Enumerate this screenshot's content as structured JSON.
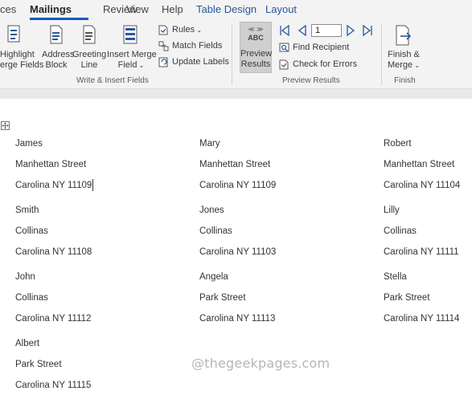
{
  "tabs": {
    "references_partial": "ces",
    "mailings": "Mailings",
    "review": "Review",
    "view": "View",
    "help": "Help",
    "table_design": "Table Design",
    "layout": "Layout"
  },
  "ribbon": {
    "write_insert": {
      "highlight_l1": "Highlight",
      "highlight_l2": "erge Fields",
      "address_l1": "Address",
      "address_l2": "Block",
      "greeting_l1": "Greeting",
      "greeting_l2": "Line",
      "insert_l1": "Insert Merge",
      "insert_l2": "Field",
      "rules": "Rules",
      "match": "Match Fields",
      "update": "Update Labels",
      "group_label": "Write & Insert Fields"
    },
    "preview": {
      "abc_glyph": "ABC",
      "preview_l1": "Preview",
      "preview_l2": "Results",
      "record_value": "1",
      "find_recipient": "Find Recipient",
      "check_errors": "Check for Errors",
      "group_label": "Preview Results"
    },
    "finish": {
      "finish_l1": "Finish &",
      "finish_l2": "Merge",
      "group_label": "Finish"
    }
  },
  "document": {
    "labels": [
      [
        "James",
        "Manhettan Street",
        "Carolina NY 11109"
      ],
      [
        "Mary",
        "Manhettan Street",
        "Carolina NY 11109"
      ],
      [
        "Robert",
        "Manhettan Street",
        "Carolina NY 11104"
      ],
      [
        "Smith",
        "Collinas",
        "Carolina NY 11108"
      ],
      [
        "Jones",
        "Collinas",
        "Carolina NY 11103"
      ],
      [
        "Lilly",
        "Collinas",
        "Carolina NY 11111"
      ],
      [
        "John",
        "Collinas",
        "Carolina NY 11112"
      ],
      [
        "Angela",
        "Park Street",
        "Carolina NY 11113"
      ],
      [
        "Stella",
        "Park Street",
        "Carolina NY 11114"
      ],
      [
        "Albert",
        "Park Street",
        "Carolina NY 11115"
      ]
    ],
    "watermark": "@thegeekpages.com"
  },
  "colors": {
    "accent": "#185abd",
    "ribbon_bg": "#f3f3f3",
    "icon_blue": "#2b579a"
  }
}
